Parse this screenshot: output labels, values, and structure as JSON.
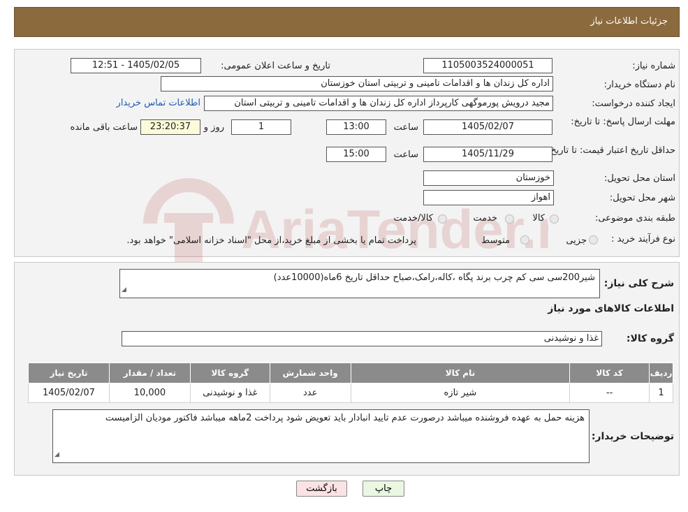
{
  "header": {
    "title": "جزئیات اطلاعات نیاز"
  },
  "form": {
    "need_number_label": "شماره نیاز:",
    "need_number": "1105003524000051",
    "announce_label": "تاریخ و ساعت اعلان عمومی:",
    "announce_value": "1405/02/05 - 12:51",
    "buyer_org_label": "نام دستگاه خریدار:",
    "buyer_org": "اداره کل زندان ها و اقدامات تامینی و تربیتی استان خوزستان",
    "creator_label": "ایجاد کننده درخواست:",
    "creator": "مجید درویش پورموگهی کارپرداز اداره کل زندان ها و اقدامات تامینی و تربیتی استان",
    "contact_link": "اطلاعات تماس خریدار",
    "deadline_label": "مهلت ارسال پاسخ: تا تاریخ:",
    "deadline_date": "1405/02/07",
    "time_word": "ساعت",
    "deadline_time": "13:00",
    "days_count": "1",
    "days_word": "روز و",
    "remaining_time": "23:20:37",
    "remaining_label": "ساعت باقی مانده",
    "validity_label": "حداقل تاریخ اعتبار قیمت: تا تاریخ:",
    "validity_date": "1405/11/29",
    "validity_time": "15:00",
    "province_label": "استان محل تحویل:",
    "province": "خوزستان",
    "city_label": "شهر محل تحویل:",
    "city": "اهواز",
    "category_label": "طبقه بندی موضوعی:",
    "category_options": [
      "کالا",
      "خدمت",
      "کالا/خدمت"
    ],
    "process_label": "نوع فرآیند خرید :",
    "process_options": [
      "جزیی",
      "متوسط"
    ],
    "process_note": "پرداخت تمام یا بخشی از مبلغ خرید،از محل \"اسناد خزانه اسلامی\" خواهد بود."
  },
  "summary": {
    "general_desc_label": "شرح کلی نیاز:",
    "general_desc": "شیر200سی سی کم چرب برند پگاه ،کاله،رامک،صباح  حداقل تاریخ 6ماه(10000عدد)",
    "goods_info_title": "اطلاعات کالاهای مورد نیاز",
    "goods_group_label": "گروه کالا:",
    "goods_group": "غذا و نوشیدنی"
  },
  "items_table": {
    "headers": [
      "ردیف",
      "کد کالا",
      "نام کالا",
      "واحد شمارش",
      "گروه کالا",
      "تعداد / مقدار",
      "تاریخ نیاز"
    ],
    "rows": [
      [
        "1",
        "--",
        "شیر تازه",
        "عدد",
        "غذا و نوشیدنی",
        "10,000",
        "1405/02/07"
      ]
    ]
  },
  "buyer_notes": {
    "label": "توضیحات خریدار:",
    "text": "هزینه حمل به عهده فروشنده میباشد درصورت عدم تایید انبادار باید تعویض شود پرداخت 2ماهه میباشد فاکتور مودیان الزامیست"
  },
  "buttons": {
    "print": "چاپ",
    "back": "بازگشت"
  },
  "watermark": {
    "text": "AriaTender.neT"
  },
  "colors": {
    "header_bg": "#8b6a3e",
    "table_header_bg": "#8b8b8b",
    "link": "#1a5bb8",
    "watermark": "#b03030"
  }
}
